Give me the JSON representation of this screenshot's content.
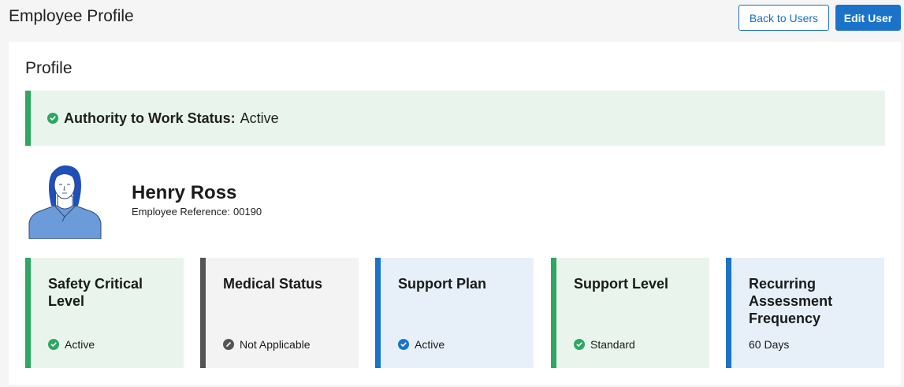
{
  "header": {
    "title": "Employee Profile",
    "back_label": "Back to Users",
    "edit_label": "Edit User"
  },
  "profile": {
    "section_title": "Profile",
    "authority": {
      "label": "Authority to Work Status:",
      "value": "Active",
      "icon": "check-circle-icon"
    },
    "employee": {
      "name": "Henry Ross",
      "reference_label": "Employee Reference:",
      "reference_value": "00190"
    },
    "cards": [
      {
        "title": "Safety Critical Level",
        "status": "Active",
        "icon": "check-circle-icon",
        "accent": "#2ea763",
        "bg": "#e9f5ec",
        "icon_color": "#2ea763"
      },
      {
        "title": "Medical Status",
        "status": "Not Applicable",
        "icon": "not-applicable-icon",
        "accent": "#555555",
        "bg": "#f3f3f3",
        "icon_color": "#555555"
      },
      {
        "title": "Support Plan",
        "status": "Active",
        "icon": "check-circle-icon",
        "accent": "#1a73c9",
        "bg": "#e7f0f8",
        "icon_color": "#1a73c9"
      },
      {
        "title": "Support Level",
        "status": "Standard",
        "icon": "check-circle-icon",
        "accent": "#2ea763",
        "bg": "#e9f5ec",
        "icon_color": "#2ea763"
      },
      {
        "title": "Recurring Assessment Frequency",
        "status": "60 Days",
        "icon": "",
        "accent": "#1a73c9",
        "bg": "#e7f0f8",
        "icon_color": ""
      }
    ]
  },
  "colors": {
    "primary": "#1a73c9",
    "success": "#2ea763",
    "neutral": "#555555"
  }
}
